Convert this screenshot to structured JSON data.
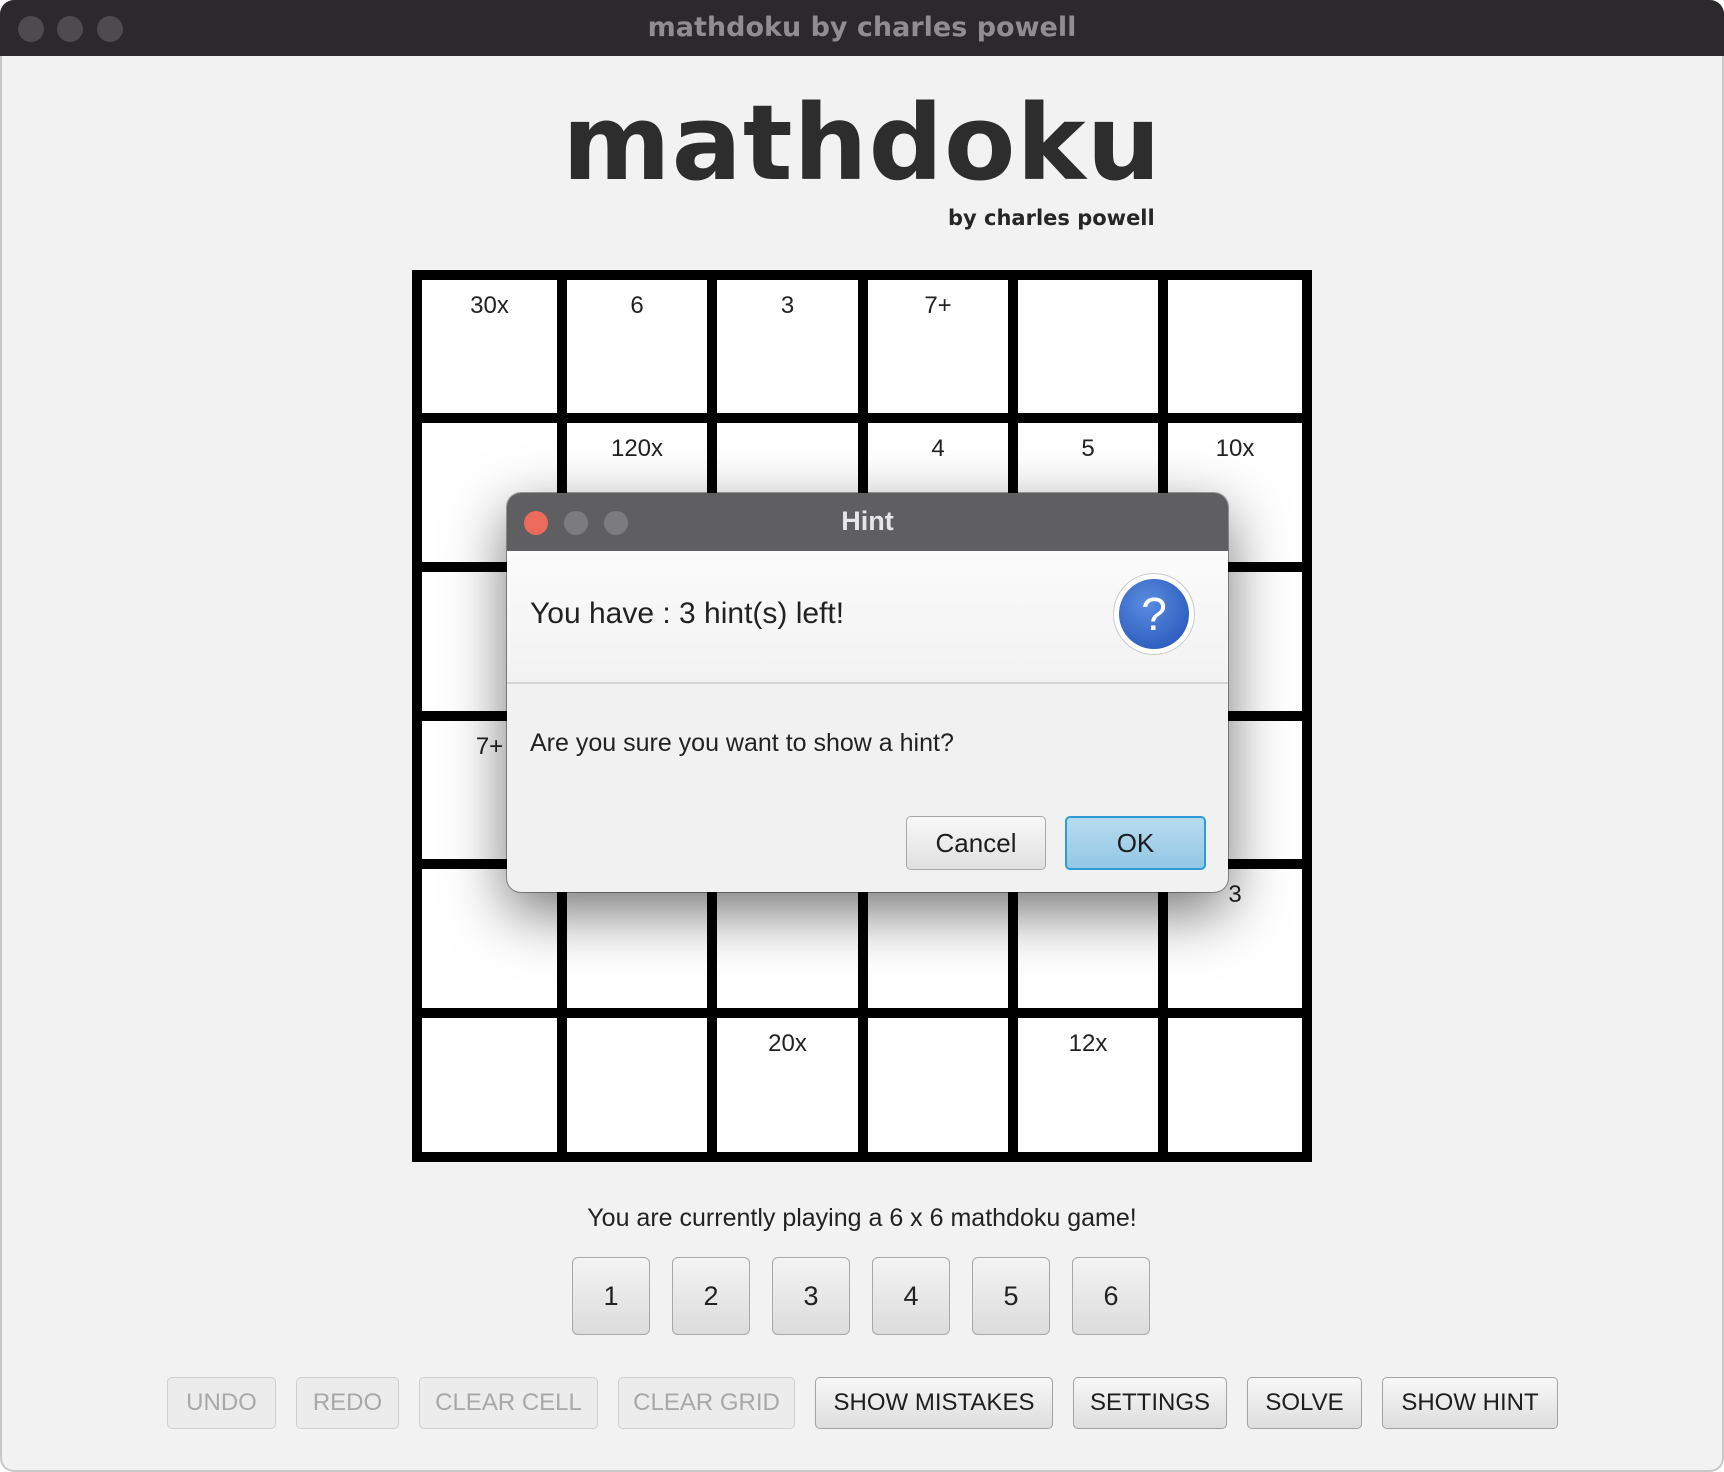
{
  "window": {
    "title": "mathdoku by charles powell"
  },
  "header": {
    "title": "mathdoku",
    "subtitle": "by charles powell"
  },
  "grid": {
    "size": 6,
    "cage_labels": [
      [
        "30x",
        "6",
        "3",
        "7+",
        "",
        ""
      ],
      [
        "",
        "120x",
        "",
        "4",
        "5",
        "10x"
      ],
      [
        "",
        "",
        "",
        "",
        "",
        ""
      ],
      [
        "7+",
        "",
        "",
        "",
        "",
        ""
      ],
      [
        "",
        "",
        "",
        "",
        "",
        "3"
      ],
      [
        "",
        "",
        "20x",
        "",
        "12x",
        ""
      ]
    ]
  },
  "status": {
    "text": "You are currently playing a 6 x 6 mathdoku game!"
  },
  "number_buttons": [
    "1",
    "2",
    "3",
    "4",
    "5",
    "6"
  ],
  "actions": {
    "undo": "UNDO",
    "redo": "REDO",
    "clear_cell": "CLEAR CELL",
    "clear_grid": "CLEAR GRID",
    "show_mistakes": "SHOW MISTAKES",
    "settings": "SETTINGS",
    "solve": "SOLVE",
    "show_hint": "SHOW HINT"
  },
  "dialog": {
    "title": "Hint",
    "header": "You have : 3 hint(s) left!",
    "message": "Are you sure you want to show a hint?",
    "icon": "question-icon",
    "cancel_label": "Cancel",
    "ok_label": "OK"
  },
  "colors": {
    "close_dot": "#ed6a5e",
    "ok_accent": "#2e9bd6"
  }
}
